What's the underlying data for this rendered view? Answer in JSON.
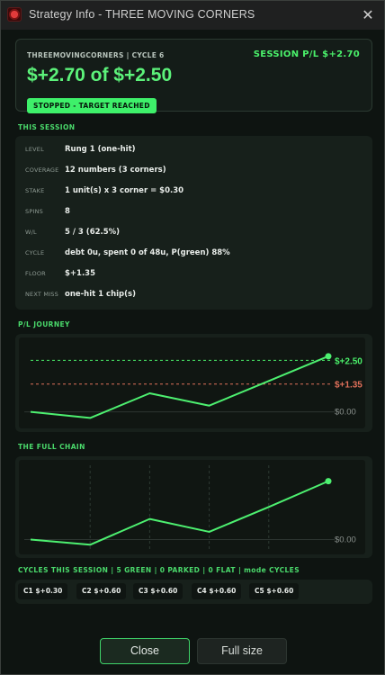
{
  "window": {
    "title": "Strategy Info - THREE MOVING CORNERS",
    "app_icon": "roulette-app-icon",
    "close_glyph": "✕"
  },
  "hero": {
    "subtitle": "THREEMOVINGCORNERS | CYCLE 6",
    "session_label": "SESSION P/L  $+2.70",
    "headline": "$+2.70 of $+2.50",
    "badge": "STOPPED - TARGET REACHED"
  },
  "this_session": {
    "label": "THIS SESSION",
    "rows": [
      {
        "key": "LEVEL",
        "value": "Rung 1 (one-hit)"
      },
      {
        "key": "COVERAGE",
        "value": "12 numbers (3 corners)"
      },
      {
        "key": "STAKE",
        "value": "1 unit(s) x 3 corner = $0.30"
      },
      {
        "key": "SPINS",
        "value": "8"
      },
      {
        "key": "W/L",
        "value": "5 / 3  (62.5%)"
      },
      {
        "key": "CYCLE",
        "value": "debt 0u, spent 0 of 48u, P(green) 88%"
      },
      {
        "key": "FLOOR",
        "value": "$+1.35"
      },
      {
        "key": "NEXT MISS",
        "value": "one-hit 1 chip(s)"
      }
    ]
  },
  "pl_journey": {
    "label": "P/L JOURNEY",
    "target_label": "$+2.50",
    "floor_label": "$+1.35",
    "zero_label": "$0.00"
  },
  "full_chain": {
    "label": "THE FULL CHAIN",
    "zero_label": "$0.00"
  },
  "cycles_section": {
    "label": "CYCLES THIS SESSION | 5 GREEN | 0 PARKED | 0 FLAT | mode CYCLES",
    "chips": [
      "C1 $+0.30",
      "C2 $+0.60",
      "C3 $+0.60",
      "C4 $+0.60",
      "C5 $+0.60"
    ]
  },
  "buttons": {
    "close": "Close",
    "full_size": "Full size"
  },
  "colors": {
    "accent_green": "#4af06a",
    "floor_red": "#e0705a",
    "axis_gray": "#8a918d"
  },
  "chart_data": [
    {
      "type": "line",
      "title": "P/L JOURNEY",
      "x": [
        0,
        1,
        2,
        3,
        4,
        5
      ],
      "series": [
        {
          "values": [
            0.0,
            -0.3,
            0.9,
            0.3,
            1.5,
            2.7
          ]
        }
      ],
      "reference_lines": [
        {
          "label": "$+2.50",
          "value": 2.5,
          "color": "#4af06a",
          "style": "dashed"
        },
        {
          "label": "$+1.35",
          "value": 1.35,
          "color": "#e0705a",
          "style": "dashed"
        }
      ],
      "baseline": {
        "label": "$0.00",
        "value": 0.0
      },
      "ylim": [
        -0.5,
        3.0
      ]
    },
    {
      "type": "line",
      "title": "THE FULL CHAIN",
      "x": [
        0,
        1,
        2,
        3,
        4,
        5
      ],
      "series": [
        {
          "values": [
            0.0,
            -0.3,
            1.2,
            0.45,
            1.9,
            3.4
          ]
        }
      ],
      "baseline": {
        "label": "$0.00",
        "value": 0.0
      },
      "grid": "vertical-dashed",
      "ylim": [
        -0.6,
        3.8
      ]
    }
  ]
}
